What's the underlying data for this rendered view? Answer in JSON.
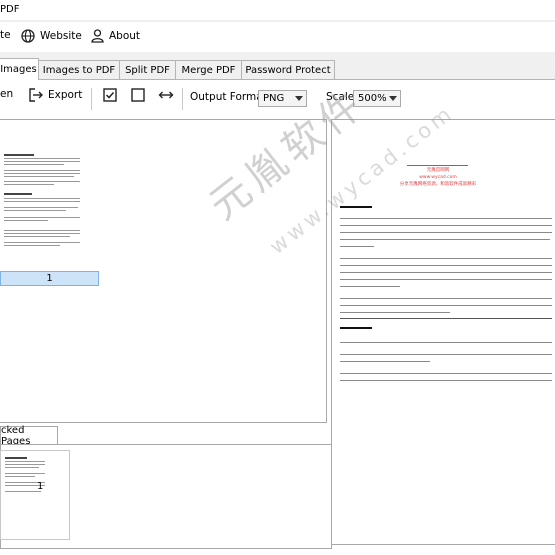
{
  "window": {
    "title": "PDF"
  },
  "menu": {
    "items": [
      {
        "label": "te",
        "icon": ""
      },
      {
        "label": "Website",
        "icon": "globe-icon"
      },
      {
        "label": "About",
        "icon": "person-icon"
      }
    ]
  },
  "tabs": [
    {
      "label": "Images",
      "active": true
    },
    {
      "label": "Images to PDF",
      "active": false
    },
    {
      "label": "Split PDF",
      "active": false
    },
    {
      "label": "Merge PDF",
      "active": false
    },
    {
      "label": "Password Protect",
      "active": false
    }
  ],
  "toolbar": {
    "open_label": "en",
    "export_label": "Export",
    "output_format_label": "Output Format:",
    "output_format_value": "PNG",
    "scale_label": "Scale:",
    "scale_value": "500%"
  },
  "left_panel": {
    "page_label": "1"
  },
  "stacked": {
    "tab_label": "cked Pages",
    "thumb_label": "1"
  },
  "preview": {
    "watermark": "元胤软件",
    "watermark_url": "www.wycad.com",
    "header_red_1": "元胤官网网",
    "header_red_2": "www.wycad.com",
    "header_red_3": "分享元胤网络资源，和谐软件成就精彩"
  },
  "colors": {
    "accent": "#2b7bd0",
    "selected_row": "#cde3f7",
    "red_text": "#e04040"
  }
}
